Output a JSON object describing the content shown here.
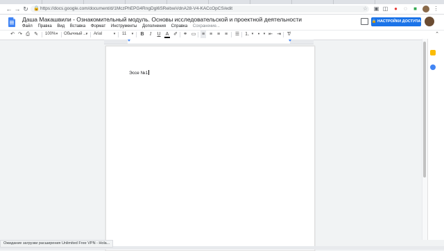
{
  "browser": {
    "url": "https://docs.google.com/document/d/1MczPhEPG4RngDgl6SReitxeVdnA28-V4-KACcOpCS/edit"
  },
  "document": {
    "title": "Даша Макашвили - Ознакомительный модуль. Основы исследовательской и проектной деятельности",
    "body_text": "Эссе №1"
  },
  "menu": {
    "file": "Файл",
    "edit": "Правка",
    "view": "Вид",
    "insert": "Вставка",
    "format": "Формат",
    "tools": "Инструменты",
    "addons": "Дополнения",
    "help": "Справка",
    "saving": "Сохранение..."
  },
  "share": {
    "label": "НАСТРОЙКИ ДОСТУПА"
  },
  "toolbar": {
    "zoom": "100%",
    "style": "Обычный ...",
    "font": "Arial",
    "size": "11"
  },
  "status": {
    "text": "Ожидание загрузки расширения Unlimited Free VPN - Hola..."
  },
  "icons": {
    "docs_logo_color": "#4285f4",
    "share_color": "#1a73e8"
  }
}
